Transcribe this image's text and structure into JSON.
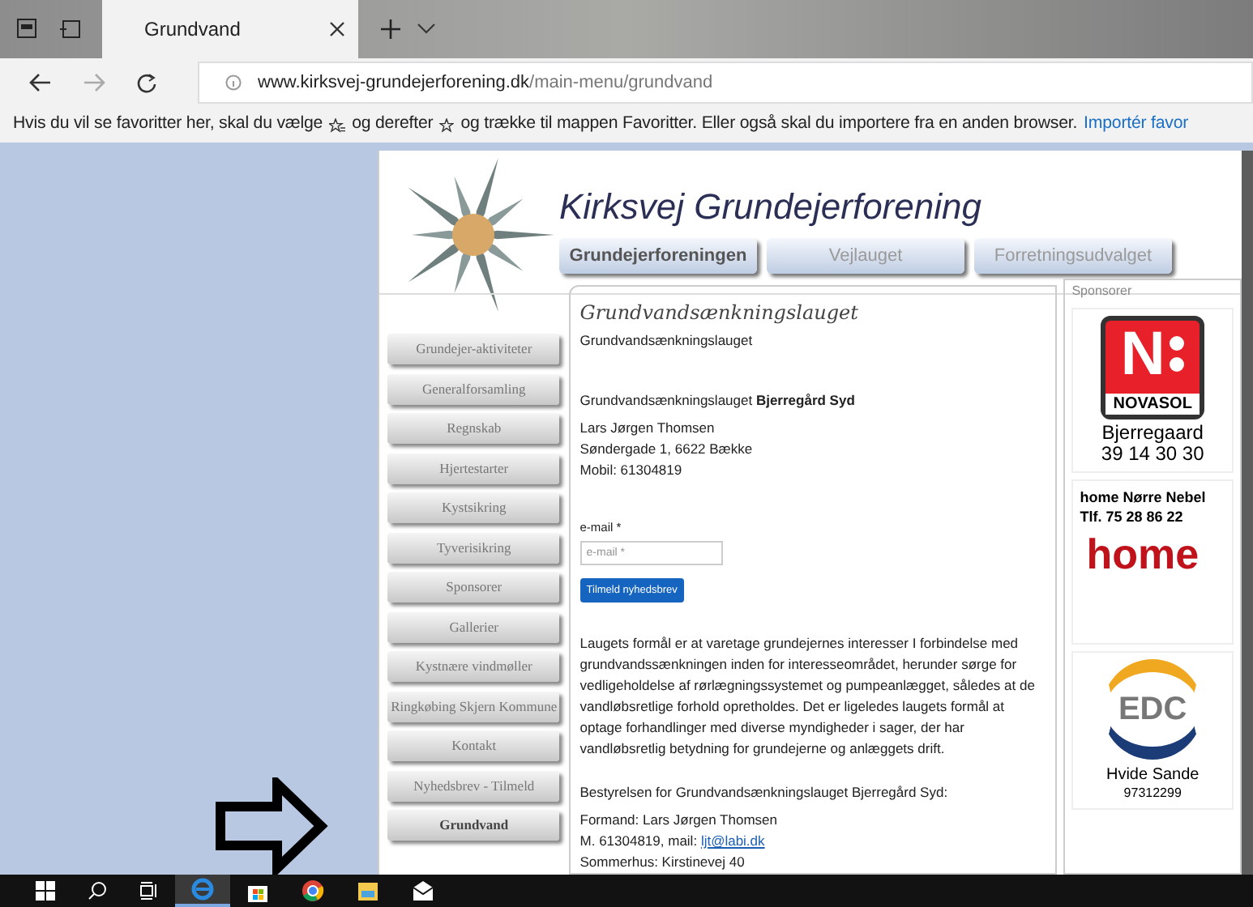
{
  "browser": {
    "tab_title": "Grundvand",
    "url_host": "www.kirksvej-grundejerforening.dk",
    "url_path": "/main-menu/grundvand",
    "favorites_hint_1": "Hvis du vil se favoritter her, skal du vælge",
    "favorites_hint_2": "og derefter",
    "favorites_hint_3": "og trække til mappen Favoritter. Eller også skal du importere fra en anden browser.",
    "import_link": "Importér favor"
  },
  "site": {
    "title": "Kirksvej Grundejerforening",
    "nav": [
      {
        "label": "Grundejerforeningen",
        "selected": true
      },
      {
        "label": "Vejlauget",
        "selected": false
      },
      {
        "label": "Forretningsudvalget",
        "selected": false
      }
    ],
    "sidebar": [
      {
        "label": "Grundejer-aktiviteter",
        "selected": false
      },
      {
        "label": "Generalforsamling",
        "selected": false
      },
      {
        "label": "Regnskab",
        "selected": false
      },
      {
        "label": "Hjertestarter",
        "selected": false
      },
      {
        "label": "Kystsikring",
        "selected": false
      },
      {
        "label": "Tyverisikring",
        "selected": false
      },
      {
        "label": "Sponsorer",
        "selected": false
      },
      {
        "label": "Gallerier",
        "selected": false
      },
      {
        "label": "Kystnære vindmøller",
        "selected": false
      },
      {
        "label": "Ringkøbing Skjern Kommune",
        "selected": false
      },
      {
        "label": "Kontakt",
        "selected": false
      },
      {
        "label": "Nyhedsbrev - Tilmeld",
        "selected": false
      },
      {
        "label": "Grundvand",
        "selected": true
      }
    ],
    "content": {
      "heading": "Grundvandsænkningslauget",
      "subtitle": "Grundvandsænkningslauget",
      "org_line": "Grundvandsænkningslauget **Bjerregård Syd**",
      "contact_lines": [
        "Lars Jørgen Thomsen",
        "Søndergade 1, 6622 Bække",
        "Mobil: 61304819"
      ],
      "email_label": "e-mail *",
      "email_placeholder": "e-mail *",
      "subscribe_button": "Tilmeld nyhedsbrev",
      "paragraph": "Laugets formål er at varetage grundejernes interesser I forbindelse med grundvandssænkningen inden for interesseområdet, herunder sørge for vedligeholdelse af rørlægningssystemet og pumpeanlægget, således at de vandløbsretlige forhold opretholdes. Det er ligeledes laugets formål at optage forhandlinger med diverse myndigheder i sager, der har vandløbsretlig betydning for grundejerne og anlæggets drift.",
      "board_heading": "Bestyrelsen for Grundvandsænkningslauget Bjerregård Syd:",
      "board_line_1": "Formand: Lars Jørgen Thomsen",
      "board_line_2": "M. 61304819, mail:",
      "board_email": "ljt@labi.dk",
      "board_line_3": "Sommerhus: Kirstinevej 40"
    },
    "sponsors": {
      "title": "Sponsorer",
      "items": [
        {
          "kind": "novasol",
          "mark": "N",
          "logo_text": "NOVASOL",
          "lines": [
            "Bjerregaard",
            "39 14 30 30"
          ]
        },
        {
          "kind": "home",
          "lines": [
            "home Nørre Nebel",
            "Tlf. 75 28 86 22"
          ],
          "logo_text": "home"
        },
        {
          "kind": "edc",
          "logo_text": "EDC",
          "lines": [
            "Hvide Sande",
            "97312299"
          ]
        }
      ]
    }
  }
}
